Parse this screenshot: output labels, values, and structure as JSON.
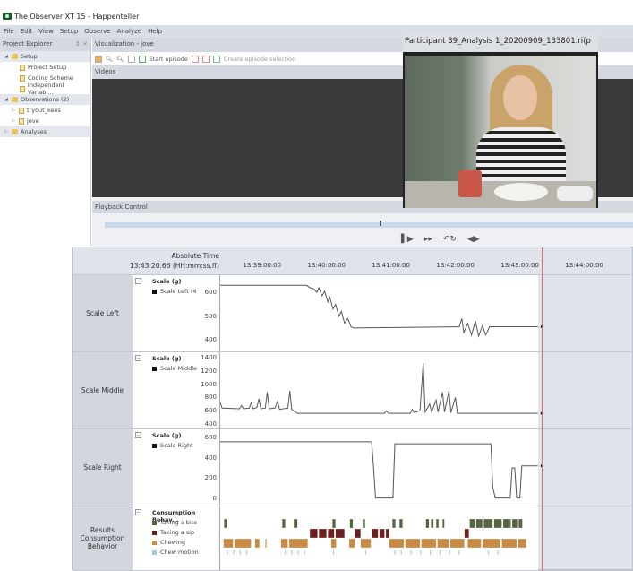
{
  "app": {
    "title": "The Observer XT 15 - Happenteller"
  },
  "menu": [
    "File",
    "Edit",
    "View",
    "Setup",
    "Observe",
    "Analyze",
    "Help"
  ],
  "explorer": {
    "title": "Project Explorer",
    "pin": "↕ ×",
    "items": [
      {
        "label": "Setup",
        "type": "group",
        "arrow": "◢"
      },
      {
        "label": "Project Setup",
        "type": "doc"
      },
      {
        "label": "Coding Scheme",
        "type": "doc"
      },
      {
        "label": "Independent Variabl...",
        "type": "doc"
      },
      {
        "label": "Observations (2)",
        "type": "group",
        "arrow": "◢"
      },
      {
        "label": "tryout_kees",
        "type": "obs",
        "arrow": "▷"
      },
      {
        "label": "jove",
        "type": "obs",
        "arrow": "▷"
      },
      {
        "label": "Analyses",
        "type": "group",
        "arrow": "▷"
      }
    ]
  },
  "visualization": {
    "title": "Visualization - jove",
    "start_episode": "Start episode",
    "create_selection": "Create episode selection",
    "videos": "Videos",
    "playback": "Playback Control",
    "playback_position": 0.52
  },
  "video": {
    "title": "Participant 39_Analysis 1_20200909_133801.ri(p"
  },
  "timeline": {
    "abs_time_label": "Absolute Time",
    "current_time": "13:43:20.66 (HH:mm:ss.ff)"
  },
  "chart_data": [
    {
      "type": "line",
      "row_label": "Scale Left",
      "title": "Scale (g)",
      "legend": "Scale Left  (4",
      "x_unit": "minutes after 13:38:00",
      "ylim": [
        370,
        650
      ],
      "yticks": [
        "600",
        "500",
        "400"
      ],
      "ytick_values": [
        600,
        500,
        400
      ],
      "color": "#555555",
      "points": [
        [
          0.35,
          630
        ],
        [
          1.69,
          630
        ],
        [
          1.74,
          620
        ],
        [
          1.8,
          615
        ],
        [
          1.85,
          600
        ],
        [
          1.88,
          620
        ],
        [
          1.93,
          585
        ],
        [
          1.97,
          605
        ],
        [
          2.02,
          560
        ],
        [
          2.05,
          580
        ],
        [
          2.1,
          530
        ],
        [
          2.14,
          550
        ],
        [
          2.19,
          500
        ],
        [
          2.23,
          520
        ],
        [
          2.28,
          470
        ],
        [
          2.33,
          490
        ],
        [
          2.38,
          455
        ],
        [
          2.43,
          450
        ],
        [
          4.06,
          455
        ],
        [
          4.1,
          490
        ],
        [
          4.13,
          430
        ],
        [
          4.19,
          470
        ],
        [
          4.25,
          420
        ],
        [
          4.31,
          480
        ],
        [
          4.36,
          415
        ],
        [
          4.42,
          460
        ],
        [
          4.47,
          420
        ],
        [
          4.53,
          455
        ],
        [
          5.28,
          455
        ]
      ]
    },
    {
      "type": "line",
      "row_label": "Scale Middle",
      "title": "Scale (g)",
      "legend": "Scale Middle",
      "ylim": [
        400,
        1400
      ],
      "yticks": [
        "1400",
        "1200",
        "1000",
        "800",
        "600",
        "400"
      ],
      "ytick_values": [
        1400,
        1200,
        1000,
        800,
        600,
        400
      ],
      "color": "#555555",
      "points": [
        [
          0.35,
          720
        ],
        [
          0.38,
          640
        ],
        [
          0.65,
          630
        ],
        [
          0.68,
          680
        ],
        [
          0.71,
          630
        ],
        [
          0.8,
          640
        ],
        [
          0.83,
          720
        ],
        [
          0.86,
          630
        ],
        [
          0.92,
          650
        ],
        [
          0.95,
          780
        ],
        [
          0.98,
          630
        ],
        [
          1.05,
          640
        ],
        [
          1.08,
          880
        ],
        [
          1.11,
          630
        ],
        [
          1.2,
          640
        ],
        [
          1.24,
          740
        ],
        [
          1.27,
          620
        ],
        [
          1.4,
          640
        ],
        [
          1.43,
          900
        ],
        [
          1.46,
          620
        ],
        [
          1.55,
          560
        ],
        [
          2.9,
          560
        ],
        [
          2.93,
          600
        ],
        [
          2.96,
          560
        ],
        [
          3.3,
          560
        ],
        [
          3.33,
          620
        ],
        [
          3.36,
          570
        ],
        [
          3.45,
          600
        ],
        [
          3.5,
          1320
        ],
        [
          3.53,
          580
        ],
        [
          3.6,
          700
        ],
        [
          3.63,
          580
        ],
        [
          3.7,
          760
        ],
        [
          3.73,
          580
        ],
        [
          3.8,
          880
        ],
        [
          3.83,
          580
        ],
        [
          3.9,
          900
        ],
        [
          3.93,
          570
        ],
        [
          4.0,
          800
        ],
        [
          4.03,
          560
        ],
        [
          5.28,
          560
        ]
      ]
    },
    {
      "type": "line",
      "row_label": "Scale Right",
      "title": "Scale (g)",
      "legend": "Scale Right",
      "ylim": [
        -30,
        630
      ],
      "yticks": [
        "600",
        "400",
        "200",
        "0"
      ],
      "ytick_values": [
        600,
        400,
        200,
        0
      ],
      "color": "#555555",
      "points": [
        [
          0.35,
          560
        ],
        [
          2.7,
          560
        ],
        [
          2.73,
          300
        ],
        [
          2.76,
          0
        ],
        [
          3.03,
          0
        ],
        [
          3.06,
          540
        ],
        [
          4.55,
          540
        ],
        [
          4.58,
          100
        ],
        [
          4.62,
          0
        ],
        [
          4.85,
          0
        ],
        [
          4.88,
          300
        ],
        [
          4.92,
          300
        ],
        [
          4.95,
          0
        ],
        [
          5.0,
          0
        ],
        [
          5.03,
          320
        ],
        [
          5.28,
          320
        ]
      ]
    },
    {
      "type": "events",
      "row_label": "Results Consumption Behavior",
      "title": "Consumption Behav...",
      "behaviors": [
        {
          "name": "Taking a bite",
          "color": "#55653f",
          "intervals": [
            [
              0.41,
              0.45
            ],
            [
              1.31,
              1.36
            ],
            [
              1.49,
              1.55
            ],
            [
              2.09,
              2.14
            ],
            [
              2.36,
              2.41
            ],
            [
              2.56,
              2.6
            ],
            [
              3.02,
              3.07
            ],
            [
              3.13,
              3.18
            ],
            [
              3.54,
              3.59
            ],
            [
              3.62,
              3.66
            ],
            [
              3.7,
              3.74
            ],
            [
              3.8,
              3.83
            ],
            [
              4.22,
              4.3
            ],
            [
              4.32,
              4.42
            ],
            [
              4.44,
              4.58
            ],
            [
              4.6,
              4.72
            ],
            [
              4.74,
              4.86
            ],
            [
              4.88,
              4.96
            ],
            [
              4.98,
              5.04
            ]
          ]
        },
        {
          "name": "Taking a sip",
          "color": "#6b1f1f",
          "intervals": [
            [
              1.74,
              1.86
            ],
            [
              1.88,
              2.0
            ],
            [
              2.02,
              2.12
            ],
            [
              2.14,
              2.28
            ],
            [
              2.44,
              2.53
            ],
            [
              2.71,
              2.8
            ],
            [
              2.82,
              2.9
            ],
            [
              2.92,
              2.97
            ],
            [
              4.14,
              4.21
            ]
          ]
        },
        {
          "name": "Chewing",
          "color": "#c98a44",
          "intervals": [
            [
              0.4,
              0.55
            ],
            [
              0.57,
              0.83
            ],
            [
              0.89,
              0.96
            ],
            [
              1.05,
              1.07
            ],
            [
              1.29,
              1.4
            ],
            [
              1.42,
              1.71
            ],
            [
              2.07,
              2.15
            ],
            [
              2.35,
              2.44
            ],
            [
              2.53,
              2.69
            ],
            [
              2.97,
              3.2
            ],
            [
              3.22,
              3.45
            ],
            [
              3.47,
              3.7
            ],
            [
              3.72,
              3.9
            ],
            [
              3.92,
              4.14
            ],
            [
              4.19,
              4.4
            ],
            [
              4.42,
              4.7
            ],
            [
              4.72,
              4.95
            ],
            [
              4.97,
              5.1
            ]
          ]
        },
        {
          "name": "Chew motion",
          "color": "#a8c8dc",
          "intervals": [
            [
              0.45,
              0.47
            ],
            [
              0.55,
              0.57
            ],
            [
              0.65,
              0.67
            ],
            [
              0.75,
              0.77
            ],
            [
              1.35,
              1.37
            ],
            [
              1.45,
              1.47
            ],
            [
              1.55,
              1.57
            ],
            [
              1.65,
              1.67
            ],
            [
              2.1,
              2.12
            ],
            [
              2.6,
              2.62
            ],
            [
              3.05,
              3.07
            ],
            [
              3.15,
              3.17
            ],
            [
              3.3,
              3.32
            ],
            [
              3.45,
              3.47
            ],
            [
              3.6,
              3.62
            ],
            [
              3.75,
              3.77
            ],
            [
              3.9,
              3.92
            ],
            [
              4.05,
              4.07
            ],
            [
              4.5,
              4.52
            ],
            [
              4.65,
              4.67
            ]
          ]
        }
      ]
    }
  ],
  "time_axis": {
    "ticks": [
      {
        "label": "13:39:00.00",
        "m": 1
      },
      {
        "label": "13:40:00.00",
        "m": 2
      },
      {
        "label": "13:41:00.00",
        "m": 3
      },
      {
        "label": "13:42:00.00",
        "m": 4
      },
      {
        "label": "13:43:00.00",
        "m": 5
      },
      {
        "label": "13:44:00.00",
        "m": 6
      }
    ],
    "range": [
      0.35,
      6.77
    ],
    "cursor": 5.344
  }
}
